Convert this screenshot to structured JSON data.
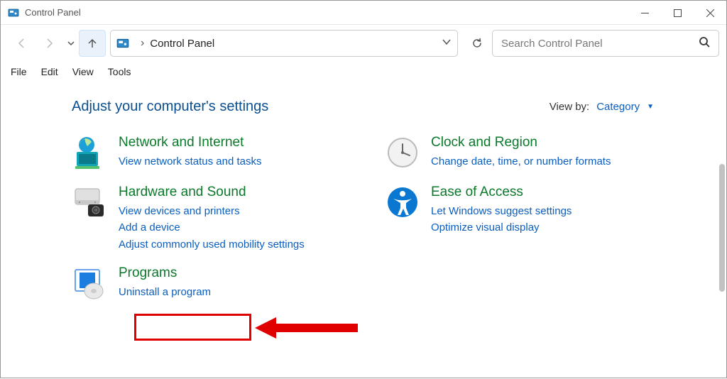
{
  "window": {
    "title": "Control Panel"
  },
  "breadcrumb": {
    "root": "Control Panel"
  },
  "search": {
    "placeholder": "Search Control Panel"
  },
  "menus": {
    "file": "File",
    "edit": "Edit",
    "view": "View",
    "tools": "Tools"
  },
  "page": {
    "title": "Adjust your computer's settings",
    "viewby_label": "View by:",
    "viewby_value": "Category"
  },
  "cats": {
    "network": {
      "title": "Network and Internet",
      "links": [
        "View network status and tasks"
      ]
    },
    "hardware": {
      "title": "Hardware and Sound",
      "links": [
        "View devices and printers",
        "Add a device",
        "Adjust commonly used mobility settings"
      ]
    },
    "programs": {
      "title": "Programs",
      "links": [
        "Uninstall a program"
      ]
    },
    "clock": {
      "title": "Clock and Region",
      "links": [
        "Change date, time, or number formats"
      ]
    },
    "ease": {
      "title": "Ease of Access",
      "links": [
        "Let Windows suggest settings",
        "Optimize visual display"
      ]
    }
  }
}
